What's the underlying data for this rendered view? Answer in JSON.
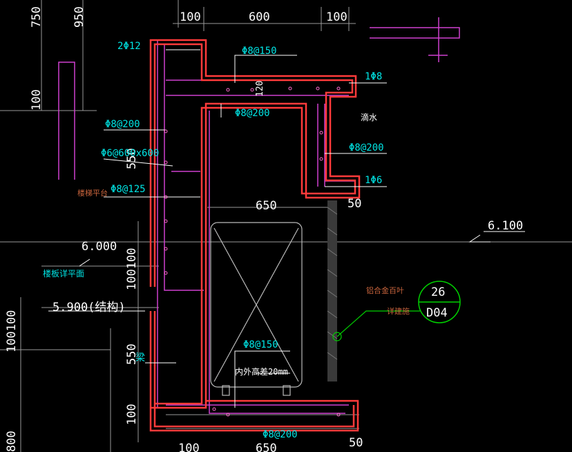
{
  "colors": {
    "background": "#000000",
    "outline_red": "#ff3b3b",
    "rebar_magenta": "#d040d0",
    "text_cyan": "#00e5e5",
    "dim_white": "#ffffff",
    "callout_green": "#00d200",
    "note_brown": "#c8643c"
  },
  "dimensions": {
    "top_left": "100",
    "top_mid": "600",
    "top_right": "100",
    "left_750": "750",
    "left_950": "950",
    "left_100": "100",
    "bottom_left_100100": "100100",
    "bottom_left_800": "800",
    "mid_550": "550",
    "mid_100100": "100100",
    "lower_550": "550",
    "lower_100": "100",
    "width_650": "650",
    "right_50": "50",
    "height_120": "120",
    "bottom_100": "100",
    "bottom_650": "650",
    "bottom_50": "50"
  },
  "levels": {
    "level_6000": "6.000",
    "level_6100": "6.100",
    "level_5900": "5.900(结构)"
  },
  "rebar_labels": {
    "top_2phi12": "2Φ12",
    "phi8_150_top": "Φ8@150",
    "phi1_8": "1Φ8",
    "phi8_200_mid": "Φ8@200",
    "phi8_200_left": "Φ8@200",
    "phi6_600": "Φ6@600x600",
    "phi8_200_right": "Φ8@200",
    "phi1_6": "1Φ6",
    "phi8_125": "Φ8@125",
    "phi8_150_bottom": "Φ8@150",
    "phi8_200_bottom": "Φ8@200"
  },
  "notes": {
    "drip": "滴水",
    "stair_platform": "楼梯平台",
    "stair_board": "楼板详平面",
    "beam": "梁",
    "height_diff": "内外高差20mm",
    "aluminum": "铝合金百叶",
    "detail_ref": "详建施"
  },
  "callout": {
    "number": "26",
    "sheet": "D04"
  }
}
